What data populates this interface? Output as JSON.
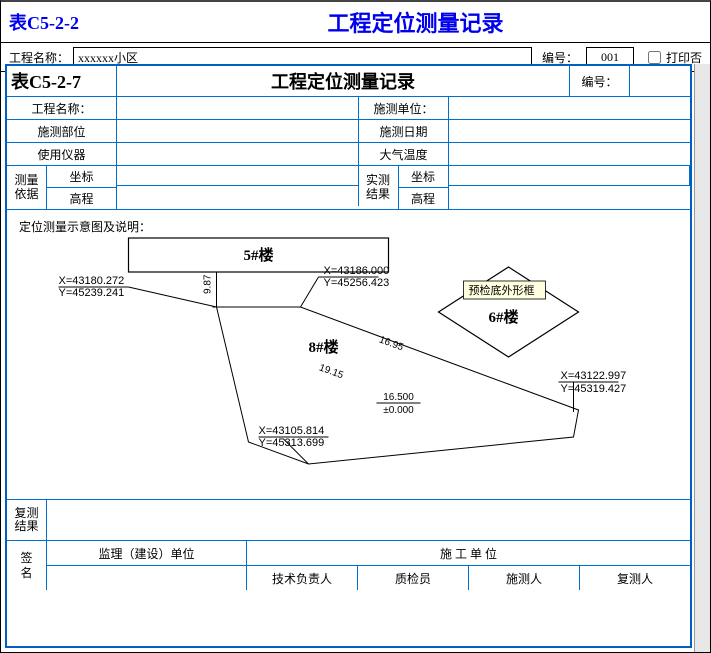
{
  "top": {
    "table_code": "表C5-2-2",
    "title": "工程定位测量记录",
    "proj_name_label": "工程名称：",
    "proj_name_value": "xxxxxx小区",
    "serial_label": "编号：",
    "serial_value": "001",
    "print_label": "打印否"
  },
  "formHeader": {
    "table_code": "表C5-2-7",
    "title": "工程定位测量记录",
    "serial_label": "编号："
  },
  "formRows": {
    "proj_name": "工程名称：",
    "survey_unit": "施测单位：",
    "survey_part": "施测部位",
    "survey_date": "施测日期",
    "instrument": "使用仪器",
    "air_temp": "大气温度",
    "basis": "测量\n依据",
    "coord": "坐标",
    "elev": "高程",
    "actual": "实测\n结果"
  },
  "diagram": {
    "caption": "定位测量示意图及说明：",
    "b5": "5#楼",
    "b6": "6#楼",
    "b8": "8#楼",
    "tooltip": "预检底外形框",
    "x1": "X=43180.272",
    "y1": "Y=45239.241",
    "dim1": "9.87",
    "x2": "X=43186.000",
    "y2": "Y=45256.423",
    "d1695": "16.95",
    "d1915": "19.15",
    "x3": "X=43122.997",
    "y3": "Y=45319.427",
    "frac_top": "16.500",
    "frac_bot": "±0.000",
    "x4": "X=43105.814",
    "y4": "Y=45313.699"
  },
  "review": "复测\n结果",
  "sig": {
    "sign": "签\n名",
    "supervise": "监理（建设）单位",
    "construct": "施 工 单 位",
    "tech": "技术负责人",
    "qc": "质检员",
    "surveyor": "施测人",
    "reviewer": "复测人"
  }
}
